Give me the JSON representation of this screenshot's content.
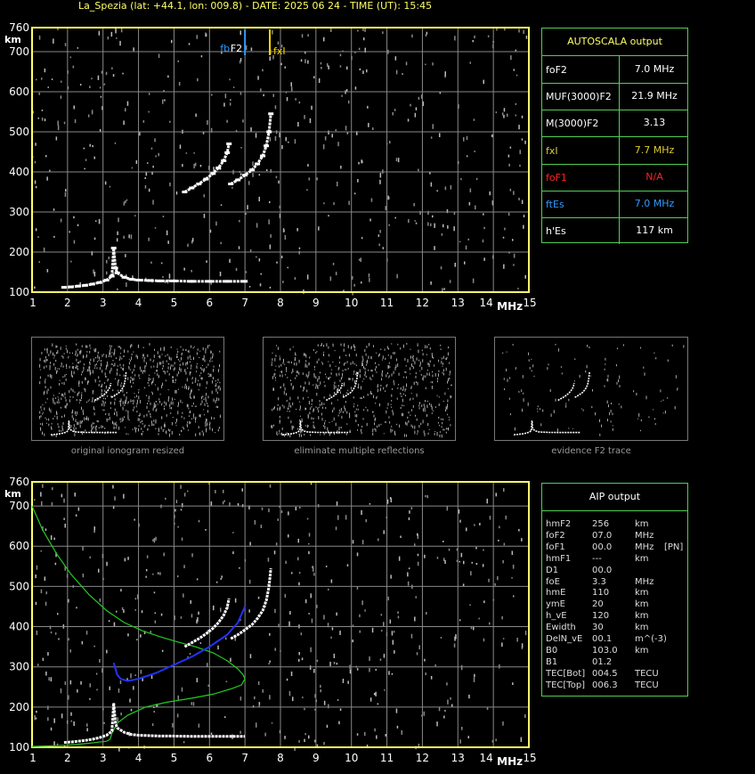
{
  "header": {
    "title": "La_Spezia (lat: +44.1, lon: 009.8) - DATE: 2025 06 24 - TIME (UT): 15:45"
  },
  "colors": {
    "frame": "#ffff66",
    "grid": "#888888",
    "panel_border": "#55cc55",
    "trace": "#ffffff",
    "fbEs": "#3399ff",
    "fxI": "#ffdd00",
    "model_green": "#22cc22",
    "model_blue": "#2233ff",
    "foF1_red": "#ff2222"
  },
  "chart_data": [
    {
      "type": "scatter",
      "title": "",
      "xlabel": "MHz",
      "ylabel": "km",
      "xlim": [
        1,
        15
      ],
      "ylim": [
        100,
        760
      ],
      "x_ticks": [
        "1",
        "2",
        "3",
        "4",
        "5",
        "6",
        "7",
        "8",
        "9",
        "10",
        "11",
        "12",
        "13",
        "14",
        "15"
      ],
      "y_ticks": [
        "100",
        "200",
        "300",
        "400",
        "500",
        "600",
        "700",
        "760"
      ],
      "grid": true,
      "markers": [
        {
          "name": "fbEs",
          "freq": 7.0,
          "color": "#3399ff"
        },
        {
          "name": "F2",
          "freq": 7.0,
          "color": "#ffffff"
        },
        {
          "name": "fxI",
          "freq": 7.7,
          "color": "#ffdd00"
        }
      ],
      "series": [
        {
          "x": [
            1.9,
            2.1,
            2.3,
            2.5,
            2.7,
            2.9,
            3.1,
            3.25,
            3.3,
            3.35,
            3.4,
            3.6,
            3.8,
            4.0,
            4.3,
            4.6,
            5.0,
            5.5,
            6.0,
            6.5,
            7.0
          ],
          "y": [
            112,
            113,
            115,
            117,
            120,
            124,
            130,
            140,
            210,
            160,
            148,
            137,
            132,
            130,
            129,
            128,
            128,
            127,
            127,
            127,
            127
          ]
        },
        {
          "x": [
            5.3,
            5.5,
            5.7,
            5.9,
            6.1,
            6.25,
            6.4,
            6.5,
            6.55
          ],
          "y": [
            350,
            360,
            370,
            382,
            396,
            410,
            428,
            448,
            470
          ]
        },
        {
          "x": [
            6.6,
            6.8,
            7.0,
            7.2,
            7.35,
            7.5,
            7.6,
            7.68,
            7.73
          ],
          "y": [
            370,
            380,
            392,
            405,
            420,
            440,
            465,
            500,
            545
          ]
        }
      ]
    },
    {
      "type": "line",
      "title": "",
      "xlabel": "MHz",
      "ylabel": "km",
      "xlim": [
        1,
        15
      ],
      "ylim": [
        100,
        760
      ],
      "x_ticks": [
        "1",
        "2",
        "3",
        "4",
        "5",
        "6",
        "7",
        "8",
        "9",
        "10",
        "11",
        "12",
        "13",
        "14",
        "15"
      ],
      "y_ticks": [
        "100",
        "200",
        "300",
        "400",
        "500",
        "600",
        "700",
        "760"
      ],
      "grid": true,
      "series": [
        {
          "x": [
            1.0,
            1.3,
            1.7,
            2.1,
            2.6,
            3.1,
            3.6,
            4.1,
            4.6,
            5.1,
            5.6,
            6.1,
            6.5,
            6.8,
            6.95,
            7.0,
            6.9,
            6.6,
            6.1,
            5.5,
            4.8,
            4.2,
            3.7,
            3.4,
            3.25,
            3.2,
            3.1,
            2.6,
            2.0,
            1.0
          ],
          "y": [
            700,
            640,
            580,
            530,
            480,
            440,
            410,
            390,
            375,
            362,
            350,
            335,
            315,
            295,
            280,
            270,
            255,
            245,
            232,
            222,
            212,
            200,
            180,
            160,
            135,
            120,
            115,
            110,
            105,
            102
          ],
          "color": "#22cc22"
        },
        {
          "x": [
            3.3,
            3.4,
            3.5,
            3.7,
            4.0,
            4.5,
            5.0,
            5.5,
            6.0,
            6.5,
            6.8,
            7.0
          ],
          "y": [
            310,
            280,
            270,
            265,
            270,
            285,
            305,
            325,
            350,
            380,
            410,
            450
          ],
          "color": "#2233ff"
        }
      ]
    }
  ],
  "autoscala": {
    "title": "AUTOSCALA output",
    "rows": [
      {
        "name": "foF2",
        "value": "7.0 MHz",
        "color": "#ffffff"
      },
      {
        "name": "MUF(3000)F2",
        "value": "21.9 MHz",
        "color": "#ffffff"
      },
      {
        "name": "M(3000)F2",
        "value": "3.13",
        "color": "#ffffff"
      },
      {
        "name": "fxI",
        "value": "7.7 MHz",
        "color": "#ddcc33"
      },
      {
        "name": "foF1",
        "value": "N/A",
        "color": "#ff2222"
      },
      {
        "name": "ftEs",
        "value": "7.0 MHz",
        "color": "#3399ff"
      },
      {
        "name": "h'Es",
        "value": "117     km",
        "color": "#ffffff"
      }
    ]
  },
  "aip": {
    "title": "AIP output",
    "rows": [
      {
        "name": "hmF2",
        "value": "256",
        "unit": "km",
        "extra": ""
      },
      {
        "name": "foF2",
        "value": "07.0",
        "unit": "MHz",
        "extra": ""
      },
      {
        "name": "foF1",
        "value": "00.0",
        "unit": "MHz",
        "extra": "[PN]"
      },
      {
        "name": "hmF1",
        "value": "---",
        "unit": "km",
        "extra": ""
      },
      {
        "name": "D1",
        "value": "00.0",
        "unit": "",
        "extra": ""
      },
      {
        "name": "foE",
        "value": "3.3",
        "unit": "MHz",
        "extra": ""
      },
      {
        "name": "hmE",
        "value": "110",
        "unit": "km",
        "extra": ""
      },
      {
        "name": "ymE",
        "value": "20",
        "unit": "km",
        "extra": ""
      },
      {
        "name": "h_vE",
        "value": "120",
        "unit": "km",
        "extra": ""
      },
      {
        "name": "Ewidth",
        "value": "30",
        "unit": "km",
        "extra": ""
      },
      {
        "name": "DelN_vE",
        "value": "00.1",
        "unit": "m^(-3)",
        "extra": ""
      },
      {
        "name": "B0",
        "value": "103.0",
        "unit": "km",
        "extra": ""
      },
      {
        "name": "B1",
        "value": "01.2",
        "unit": "",
        "extra": ""
      },
      {
        "name": "TEC[Bot]",
        "value": "004.5",
        "unit": "TECU",
        "extra": ""
      },
      {
        "name": "TEC[Top]",
        "value": "006.3",
        "unit": "TECU",
        "extra": ""
      }
    ]
  },
  "thumbnails": [
    {
      "caption": "original ionogram resized"
    },
    {
      "caption": "eliminate multiple reflections"
    },
    {
      "caption": "evidence F2 trace"
    }
  ]
}
